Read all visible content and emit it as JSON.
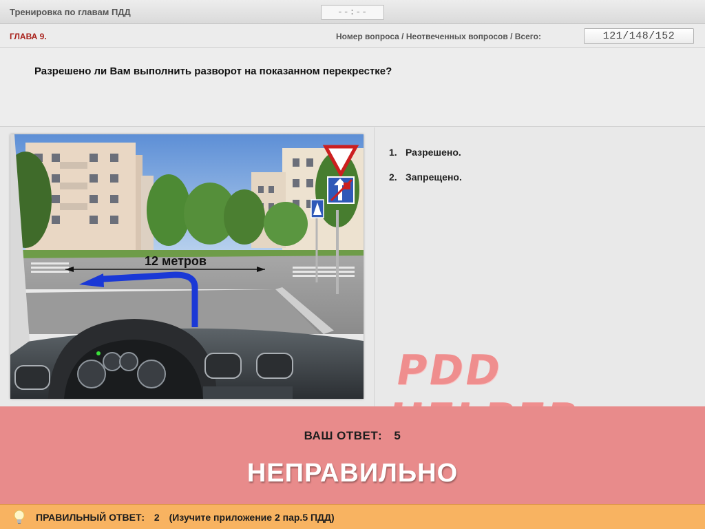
{
  "window": {
    "title": "Тренировка по главам ПДД",
    "timer": "--:--"
  },
  "chapter": {
    "label": "ГЛАВА 9.",
    "counter_label": "Номер вопроса / Неотвеченных вопросов / Всего:",
    "counter_value": "121/148/152"
  },
  "question": {
    "text": "Разрешено ли Вам выполнить разворот на показанном перекрестке?"
  },
  "image": {
    "caption": "12 метров"
  },
  "answers": [
    {
      "num": "1.",
      "label": "Разрешено."
    },
    {
      "num": "2.",
      "label": "Запрещено."
    }
  ],
  "watermark": "PDD HELPER",
  "result": {
    "your_answer_label": "ВАШ ОТВЕТ:",
    "your_answer_value": "5",
    "verdict": "НЕПРАВИЛЬНО"
  },
  "correct": {
    "label": "ПРАВИЛЬНЫЙ ОТВЕТ:",
    "value": "2",
    "note": "(Изучите приложение 2 пар.5 ПДД)"
  },
  "colors": {
    "chapter_red": "#a8201a",
    "result_bg": "#e88b8b",
    "correct_bg": "#f8b361",
    "watermark": "#ef8e8e"
  }
}
